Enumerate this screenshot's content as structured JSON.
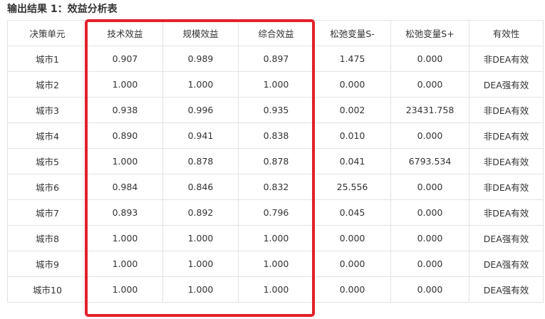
{
  "title": "输出结果 1：效益分析表",
  "columns": [
    "决策单元",
    "技术效益",
    "规模效益",
    "综合效益",
    "松弛变量S-",
    "松弛变量S+",
    "有效性"
  ],
  "rows": [
    [
      "城市1",
      "0.907",
      "0.989",
      "0.897",
      "1.475",
      "0.000",
      "非DEA有效"
    ],
    [
      "城市2",
      "1.000",
      "1.000",
      "1.000",
      "0.000",
      "0.000",
      "DEA强有效"
    ],
    [
      "城市3",
      "0.938",
      "0.996",
      "0.935",
      "0.002",
      "23431.758",
      "非DEA有效"
    ],
    [
      "城市4",
      "0.890",
      "0.941",
      "0.838",
      "0.010",
      "0.000",
      "非DEA有效"
    ],
    [
      "城市5",
      "1.000",
      "0.878",
      "0.878",
      "0.041",
      "6793.534",
      "非DEA有效"
    ],
    [
      "城市6",
      "0.984",
      "0.846",
      "0.832",
      "25.556",
      "0.000",
      "非DEA有效"
    ],
    [
      "城市7",
      "0.893",
      "0.892",
      "0.796",
      "0.045",
      "0.000",
      "非DEA有效"
    ],
    [
      "城市8",
      "1.000",
      "1.000",
      "1.000",
      "0.000",
      "0.000",
      "DEA强有效"
    ],
    [
      "城市9",
      "1.000",
      "1.000",
      "1.000",
      "0.000",
      "0.000",
      "DEA强有效"
    ],
    [
      "城市10",
      "1.000",
      "1.000",
      "1.000",
      "0.000",
      "0.000",
      "DEA强有效"
    ]
  ],
  "highlight": {
    "color": "#e3202a",
    "columns": [
      "技术效益",
      "规模效益",
      "综合效益"
    ]
  }
}
